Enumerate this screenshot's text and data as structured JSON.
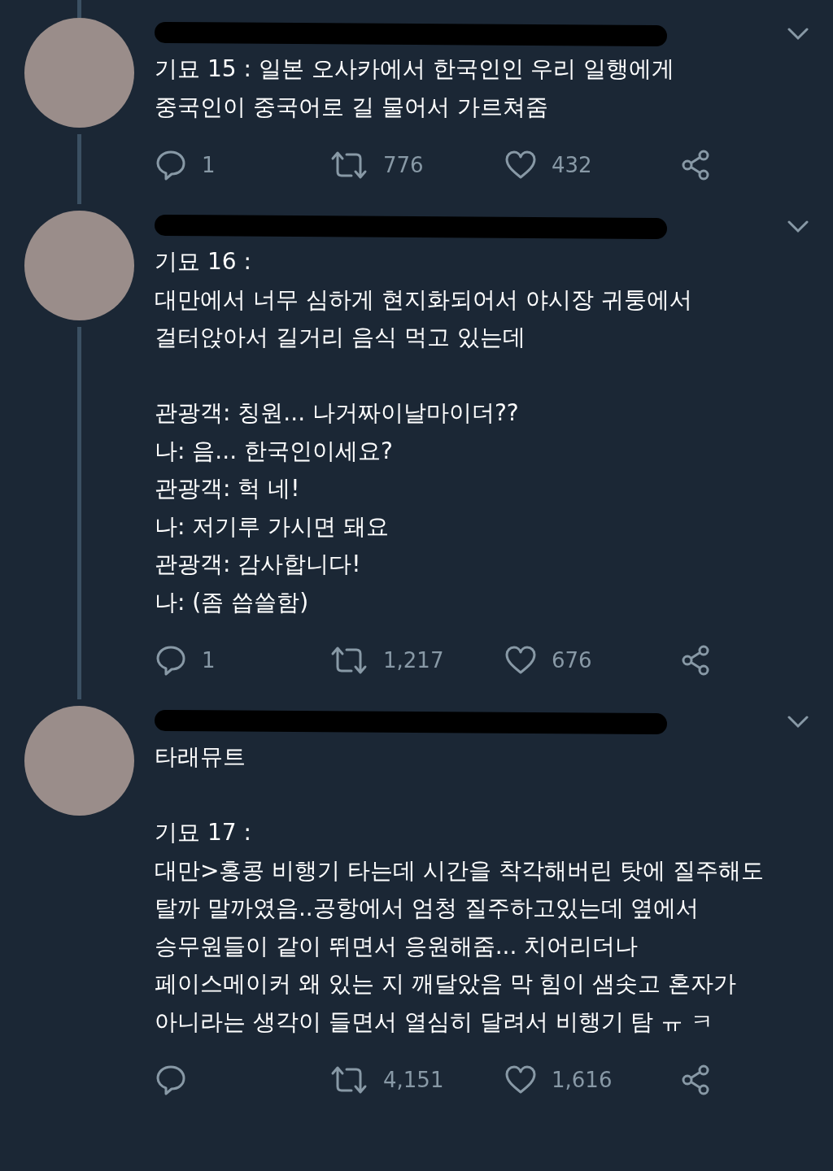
{
  "tweets": [
    {
      "connected_above": true,
      "connected_below": true,
      "header_redacted": true,
      "text": "기묘 15 : 일본 오사카에서 한국인인 우리 일행에게\n중국인이 중국어로 길 물어서 가르쳐줌",
      "replies": "1",
      "retweets": "776",
      "likes": "432"
    },
    {
      "connected_above": false,
      "connected_below": true,
      "header_redacted": true,
      "text": "기묘 16 :\n대만에서 너무 심하게 현지화되어서 야시장 귀퉁에서\n걸터앉아서 길거리 음식 먹고 있는데\n\n관광객: 칭원... 나거짜이날마이더??\n나: 음... 한국인이세요?\n관광객: 헉 네!\n나: 저기루 가시면 돼요\n관광객: 감사합니다!\n나: (좀 씁쓸함)",
      "replies": "1",
      "retweets": "1,217",
      "likes": "676"
    },
    {
      "connected_above": false,
      "connected_below": false,
      "header_redacted": true,
      "text": "타래뮤트\n\n기묘 17 :\n대만>홍콩 비행기 타는데 시간을 착각해버린 탓에 질주해도\n탈까 말까였음..공항에서 엄청 질주하고있는데 옆에서\n승무원들이 같이 뛰면서 응원해줌... 치어리더나\n페이스메이커 왜 있는 지 깨달았음 막 힘이 샘솟고 혼자가\n아니라는 생각이 들면서 열심히 달려서 비행기 탐 ㅠ ㅋ",
      "retweets": "4,151",
      "likes": "1,616"
    }
  ]
}
